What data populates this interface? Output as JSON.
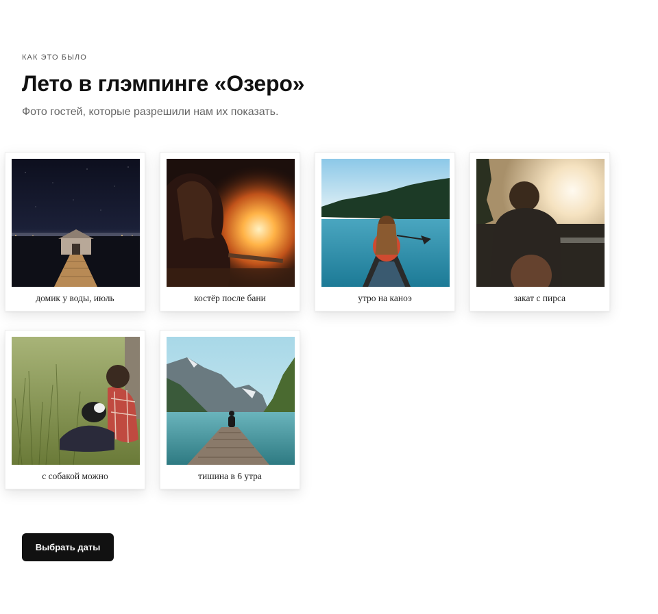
{
  "header": {
    "eyebrow": "КАК ЭТО БЫЛО",
    "title": "Лето в глэмпинге «Озеро»",
    "subtitle": "Фото гостей, которые разрешили нам их показать."
  },
  "gallery": [
    {
      "caption": "домик у воды, июль"
    },
    {
      "caption": "костёр после бани"
    },
    {
      "caption": "утро на каноэ"
    },
    {
      "caption": "закат с пирса"
    },
    {
      "caption": "с собакой можно"
    },
    {
      "caption": "тишина в 6 утра"
    }
  ],
  "cta": {
    "label": "Выбрать даты"
  }
}
